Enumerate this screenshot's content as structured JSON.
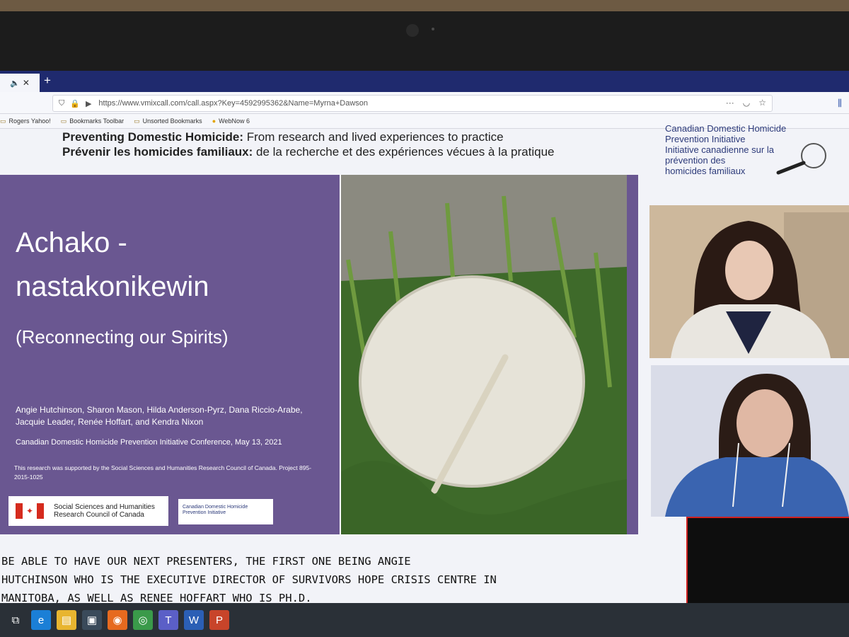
{
  "browser": {
    "tab_mute_icon": "speaker-icon",
    "tab_close": "✕",
    "new_tab": "+",
    "url": "https://www.vmixcall.com/call.aspx?Key=4592995362&Name=Myrna+Dawson",
    "more": "···"
  },
  "bookmarks": [
    {
      "label": "Rogers Yahoo!"
    },
    {
      "label": "Bookmarks Toolbar"
    },
    {
      "label": "Unsorted Bookmarks"
    },
    {
      "label": "WebNow 6"
    }
  ],
  "banner": {
    "en_bold": "Preventing Domestic Homicide:",
    "en_rest": " From research and lived experiences to practice",
    "fr_bold": "Prévenir les homicides familiaux:",
    "fr_rest": " de la recherche et des expériences vécues à la pratique"
  },
  "logo": {
    "line1": "Canadian Domestic Homicide",
    "line2": "Prevention Initiative",
    "line3": "Initiative canadienne sur la",
    "line4": "prévention des",
    "line5": "homicides familiaux"
  },
  "slide": {
    "title_line1": "Achako -",
    "title_line2": "nastakonikewin",
    "subtitle": "(Reconnecting our Spirits)",
    "authors": "Angie Hutchinson, Sharon Mason, Hilda Anderson-Pyrz, Dana Riccio-Arabe, Jacquie Leader, Renée Hoffart, and Kendra Nixon",
    "conference": "Canadian Domestic Homicide Prevention Initiative Conference, May 13, 2021",
    "support": "This research was supported by the Social Sciences and Humanities Research Council of Canada. Project 895-2015-1025",
    "sshrc_line1": "Social Sciences and Humanities",
    "sshrc_line2": "Research Council of Canada",
    "cdhpi_line1": "Canadian Domestic Homicide",
    "cdhpi_line2": "Prevention Initiative"
  },
  "captions": [
    "BE ABLE TO HAVE OUR NEXT  PRESENTERS, THE FIRST ONE BEING ANGIE",
    "HUTCHINSON WHO IS THE EXECUTIVE DIRECTOR OF SURVIVORS HOPE CRISIS CENTRE IN",
    "MANITOBA, AS WELL AS RENEE HOFFART WHO IS PH.D."
  ],
  "taskbar": [
    {
      "icon": "task-view-icon",
      "color": "#2a3037"
    },
    {
      "icon": "edge-icon",
      "color": "#1b7fd6"
    },
    {
      "icon": "file-explorer-icon",
      "color": "#e8b530"
    },
    {
      "icon": "store-icon",
      "color": "#3a4a5a"
    },
    {
      "icon": "firefox-icon",
      "color": "#e66a1f"
    },
    {
      "icon": "chrome-icon",
      "color": "#3a9a4a"
    },
    {
      "icon": "teams-icon",
      "color": "#5b5fc7"
    },
    {
      "icon": "word-icon",
      "color": "#2b5fb5"
    },
    {
      "icon": "powerpoint-icon",
      "color": "#c8442a"
    }
  ]
}
